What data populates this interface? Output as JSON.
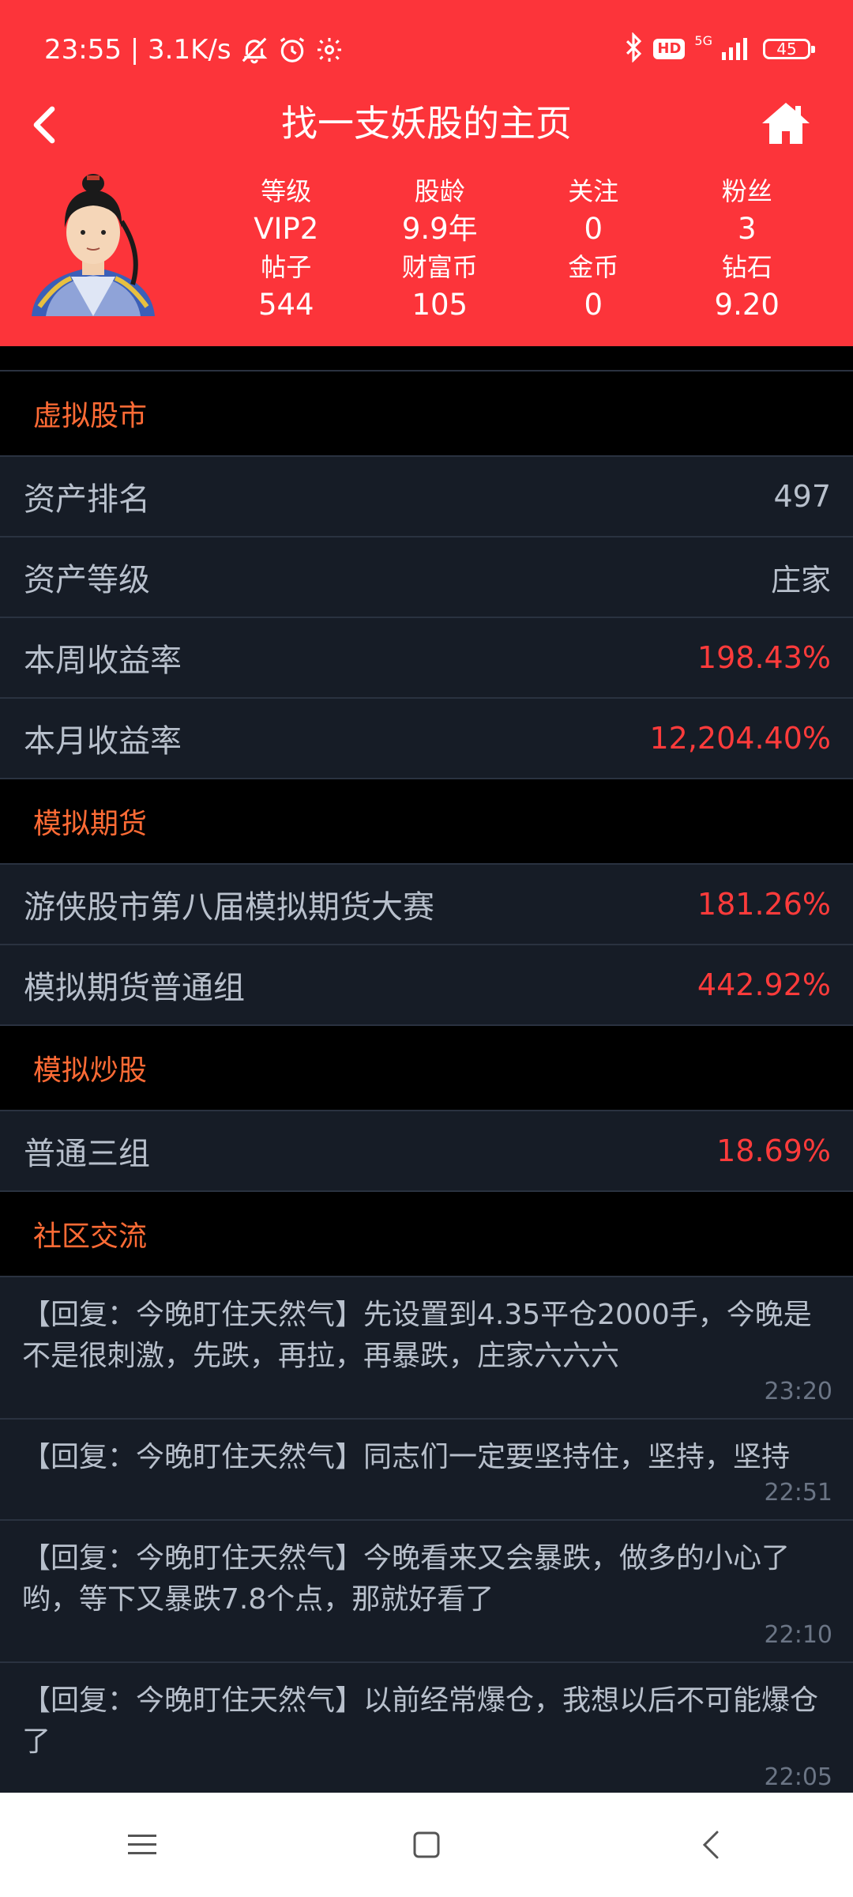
{
  "status_bar": {
    "time_speed": "23:55 | 3.1K/s",
    "hd": "HD",
    "network": "5G",
    "battery": "45"
  },
  "nav": {
    "title": "找一支妖股的主页"
  },
  "profile": {
    "stats": [
      {
        "label": "等级",
        "value": "VIP2"
      },
      {
        "label": "股龄",
        "value": "9.9年"
      },
      {
        "label": "关注",
        "value": "0"
      },
      {
        "label": "粉丝",
        "value": "3"
      },
      {
        "label": "帖子",
        "value": "544"
      },
      {
        "label": "财富币",
        "value": "105"
      },
      {
        "label": "金币",
        "value": "0"
      },
      {
        "label": "钻石",
        "value": "9.20"
      }
    ]
  },
  "sections": {
    "virtual_stock": {
      "title": "虚拟股市",
      "rows": [
        {
          "label": "资产排名",
          "value": "497"
        },
        {
          "label": "资产等级",
          "value": "庄家"
        },
        {
          "label": "本周收益率",
          "value": "198.43%"
        },
        {
          "label": "本月收益率",
          "value": "12,204.40%"
        }
      ]
    },
    "futures": {
      "title": "模拟期货",
      "rows": [
        {
          "label": "游侠股市第八届模拟期货大赛",
          "value": "181.26%"
        },
        {
          "label": "模拟期货普通组",
          "value": "442.92%"
        }
      ]
    },
    "stock_trading": {
      "title": "模拟炒股",
      "rows": [
        {
          "label": "普通三组",
          "value": "18.69%"
        }
      ]
    },
    "community": {
      "title": "社区交流",
      "posts": [
        {
          "text": "【回复：今晚盯住天然气】先设置到4.35平仓2000手，今晚是不是很刺激，先跌，再拉，再暴跌，庄家六六六",
          "time": "23:20"
        },
        {
          "text": "【回复：今晚盯住天然气】同志们一定要坚持住，坚持，坚持",
          "time": "22:51"
        },
        {
          "text": "【回复：今晚盯住天然气】今晚看来又会暴跌，做多的小心了哟，等下又暴跌7.8个点，那就好看了",
          "time": "22:10"
        },
        {
          "text": "【回复：今晚盯住天然气】以前经常爆仓，我想以后不可能爆仓了",
          "time": "22:05"
        }
      ]
    }
  },
  "colors": {
    "header_bg": "#fc343a",
    "section_title": "#ff6b35",
    "positive_value": "#ff3b3b",
    "row_bg": "#161c26"
  }
}
